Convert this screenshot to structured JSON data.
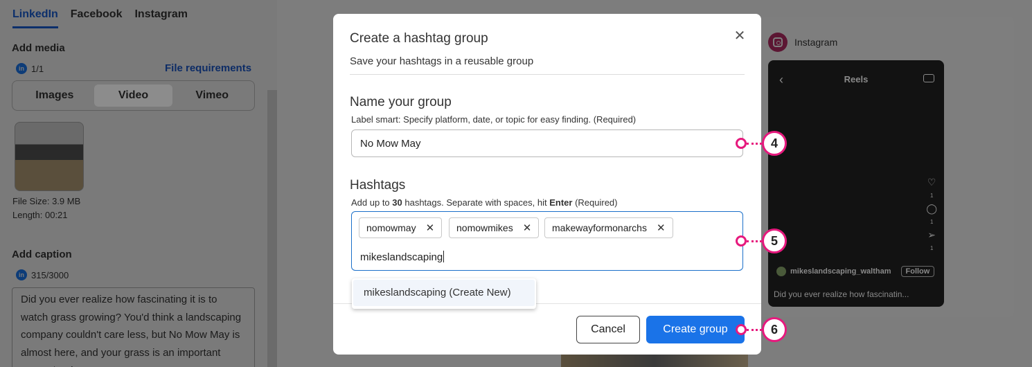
{
  "tabs": [
    "LinkedIn",
    "Facebook",
    "Instagram"
  ],
  "media": {
    "title": "Add media",
    "counter": "1/1",
    "file_requirements": "File requirements",
    "segments": [
      "Images",
      "Video",
      "Vimeo"
    ],
    "file_size": "File Size: 3.9 MB",
    "length": "Length: 00:21"
  },
  "caption": {
    "title": "Add caption",
    "counter": "315/3000",
    "text": "Did you ever realize how fascinating it is to watch grass growing? You'd think a landscaping company couldn't care less, but No Mow May is almost here, and your grass is an important ecosystem!"
  },
  "preview": {
    "network": "Instagram",
    "reels_title": "Reels",
    "side_counts": [
      "1",
      "1",
      "1"
    ],
    "username": "mikeslandscaping_waltham",
    "follow": "Follow",
    "caption": "Did you ever realize how fascinatin..."
  },
  "modal": {
    "title": "Create a hashtag group",
    "close_glyph": "✕",
    "subtitle": "Save your hashtags in a reusable group",
    "name_label": "Name your group",
    "name_help": "Label smart: Specify platform, date, or topic for easy finding.  (Required)",
    "name_value": "No Mow May",
    "hashtags_label": "Hashtags",
    "hashtags_help_pre": "Add up to ",
    "hashtags_help_max": "30",
    "hashtags_help_mid": " hashtags. Separate with spaces, hit ",
    "hashtags_help_key": "Enter",
    "hashtags_help_post": "  (Required)",
    "chips": [
      "nomowmay",
      "nomowmikes",
      "makewayformonarchs"
    ],
    "chip_remove_glyph": "✕",
    "current_entry": "mikeslandscaping",
    "suggestion": "mikeslandscaping (Create New)",
    "cancel": "Cancel",
    "create": "Create group"
  },
  "callouts": [
    "4",
    "5",
    "6"
  ],
  "colors": {
    "primary": "#1a73e8",
    "callout": "#e6197d",
    "focus_border": "#1a6fc9"
  }
}
